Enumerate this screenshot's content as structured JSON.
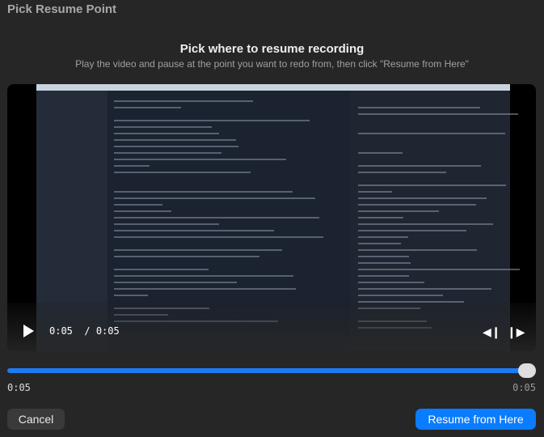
{
  "window": {
    "title": "Pick Resume Point"
  },
  "header": {
    "heading": "Pick where to resume recording",
    "subtitle": "Play the video and pause at the point you want to redo from, then click \"Resume from Here\""
  },
  "player": {
    "current_time": "0:05",
    "duration": "0:05",
    "time_separator": "/",
    "icons": [
      "play-icon",
      "skip-back-icon",
      "skip-forward-icon"
    ]
  },
  "scrubber": {
    "progress": 1.0,
    "start_label": "0:05",
    "end_label": "0:05",
    "color": "#1e7cf2"
  },
  "actions": {
    "cancel": "Cancel",
    "resume": "Resume from Here",
    "accent": "#0a7cff"
  }
}
